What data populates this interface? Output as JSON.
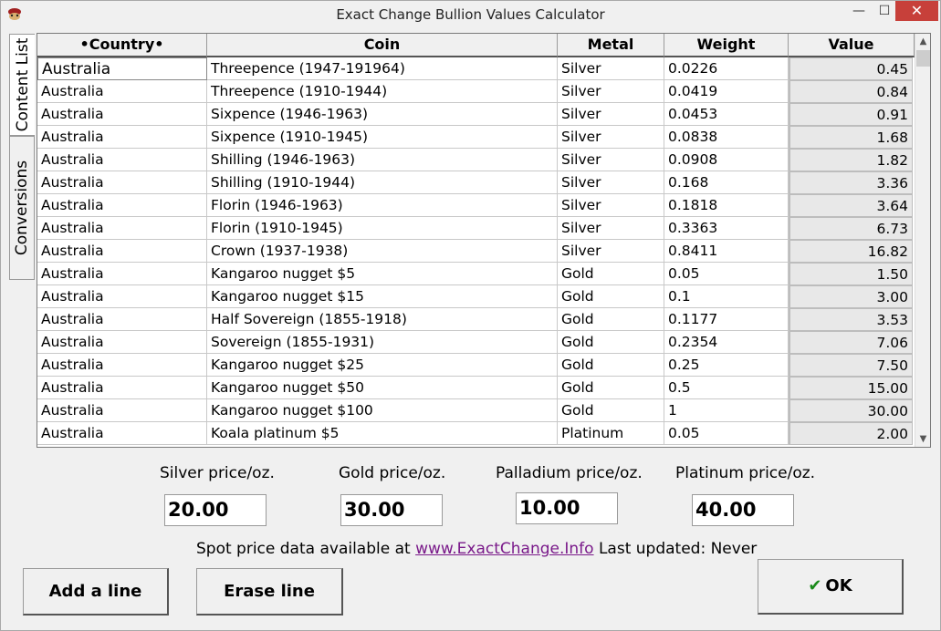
{
  "window": {
    "title": "Exact Change Bullion Values Calculator",
    "min": "—",
    "max": "☐",
    "close": "✕"
  },
  "tabs": [
    "Content List",
    "Conversions"
  ],
  "table": {
    "headers": [
      "•Country•",
      "Coin",
      "Metal",
      "Weight",
      "Value"
    ],
    "rows": [
      [
        "Australia",
        "Threepence (1947-191964)",
        "Silver",
        "0.0226",
        "0.45"
      ],
      [
        "Australia",
        "Threepence (1910-1944)",
        "Silver",
        "0.0419",
        "0.84"
      ],
      [
        "Australia",
        "Sixpence (1946-1963)",
        "Silver",
        "0.0453",
        "0.91"
      ],
      [
        "Australia",
        "Sixpence (1910-1945)",
        "Silver",
        "0.0838",
        "1.68"
      ],
      [
        "Australia",
        "Shilling (1946-1963)",
        "Silver",
        "0.0908",
        "1.82"
      ],
      [
        "Australia",
        "Shilling (1910-1944)",
        "Silver",
        "0.168",
        "3.36"
      ],
      [
        "Australia",
        "Florin (1946-1963)",
        "Silver",
        "0.1818",
        "3.64"
      ],
      [
        "Australia",
        "Florin (1910-1945)",
        "Silver",
        "0.3363",
        "6.73"
      ],
      [
        "Australia",
        "Crown (1937-1938)",
        "Silver",
        "0.8411",
        "16.82"
      ],
      [
        "Australia",
        "Kangaroo nugget $5",
        "Gold",
        "0.05",
        "1.50"
      ],
      [
        "Australia",
        "Kangaroo nugget $15",
        "Gold",
        "0.1",
        "3.00"
      ],
      [
        "Australia",
        "Half Sovereign (1855-1918)",
        "Gold",
        "0.1177",
        "3.53"
      ],
      [
        "Australia",
        "Sovereign (1855-1931)",
        "Gold",
        "0.2354",
        "7.06"
      ],
      [
        "Australia",
        "Kangaroo nugget $25",
        "Gold",
        "0.25",
        "7.50"
      ],
      [
        "Australia",
        "Kangaroo nugget $50",
        "Gold",
        "0.5",
        "15.00"
      ],
      [
        "Australia",
        "Kangaroo nugget $100",
        "Gold",
        "1",
        "30.00"
      ],
      [
        "Australia",
        "Koala platinum $5",
        "Platinum",
        "0.05",
        "2.00"
      ]
    ]
  },
  "prices": {
    "silver_label": "Silver price/oz.",
    "silver_value": "20.00",
    "gold_label": "Gold price/oz.",
    "gold_value": "30.00",
    "palladium_label": "Palladium price/oz.",
    "palladium_value": "10.00",
    "platinum_label": "Platinum price/oz.",
    "platinum_value": "40.00"
  },
  "spot": {
    "prefix": "Spot price data available at",
    "link": "www.ExactChange.Info",
    "updated": "Last updated: Never"
  },
  "buttons": {
    "add": "Add a line",
    "erase": "Erase line",
    "ok": "OK",
    "ok_icon": "✔"
  }
}
